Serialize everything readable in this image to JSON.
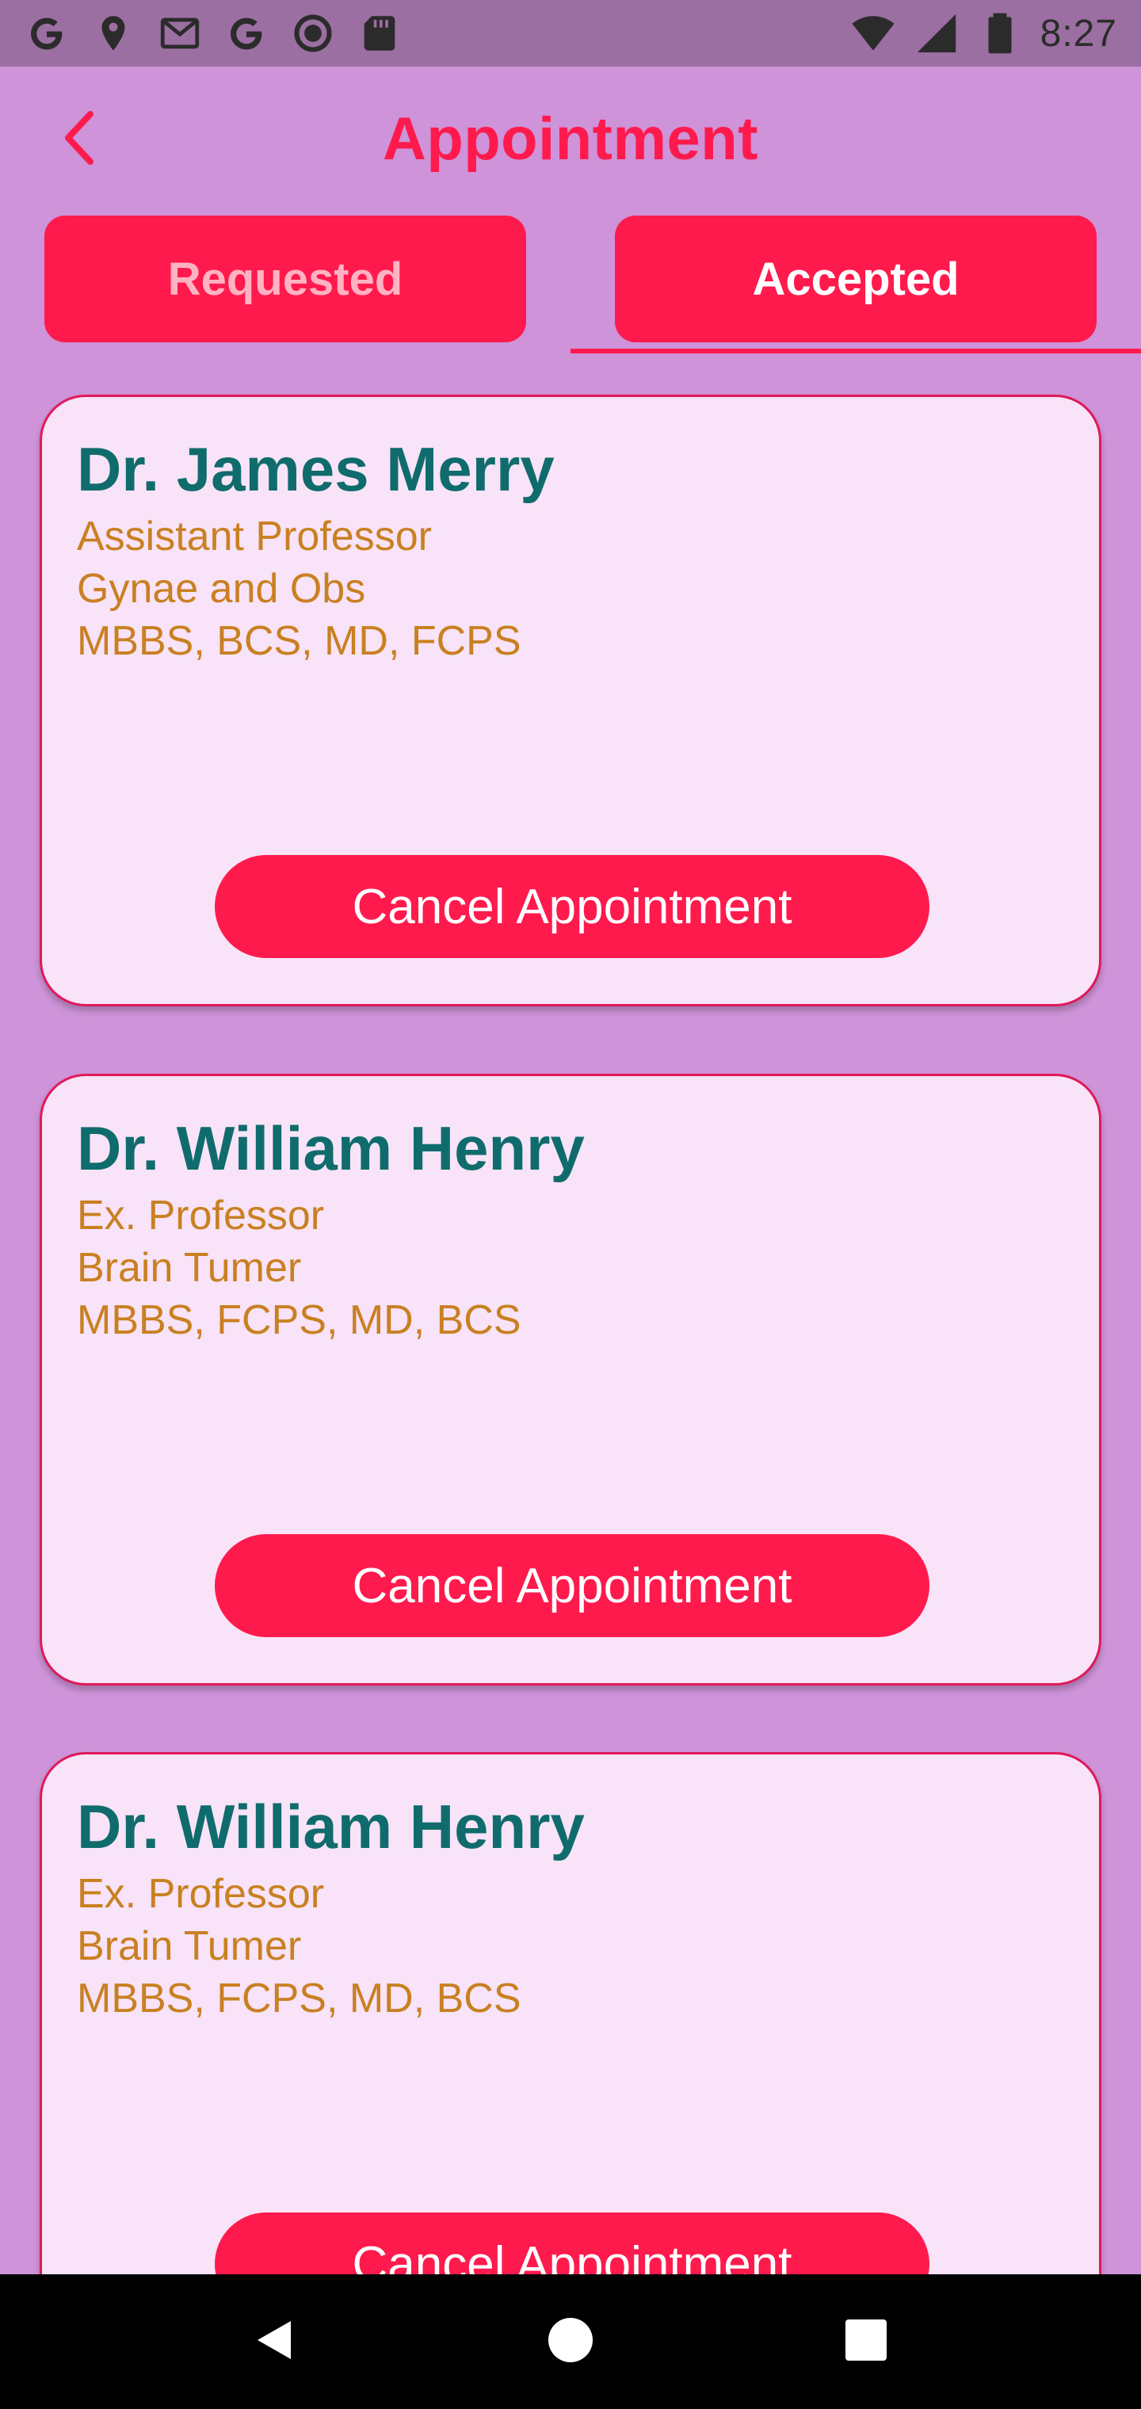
{
  "status_bar": {
    "time": "8:27",
    "left_icons": [
      "google-icon",
      "location-pin-icon",
      "gmail-icon",
      "google-icon",
      "record-icon",
      "sd-card-icon"
    ],
    "right_icons": [
      "wifi-icon",
      "cellular-signal-icon",
      "battery-icon"
    ]
  },
  "app_bar": {
    "title": "Appointment",
    "back_icon": "chevron-left-icon"
  },
  "tabs": [
    {
      "label": "Requested",
      "selected": false
    },
    {
      "label": "Accepted",
      "selected": true
    }
  ],
  "appointments": [
    {
      "name": "Dr. James Merry",
      "position": "Assistant Professor",
      "department": "Gynae and Obs",
      "degrees": "MBBS, BCS, MD, FCPS",
      "button_label": "Cancel Appointment"
    },
    {
      "name": "Dr. William Henry",
      "position": "Ex. Professor",
      "department": "Brain Tumer",
      "degrees": "MBBS, FCPS, MD, BCS",
      "button_label": "Cancel Appointment"
    },
    {
      "name": "Dr. William Henry",
      "position": "Ex. Professor",
      "department": "Brain Tumer",
      "degrees": "MBBS, FCPS, MD, BCS",
      "button_label": "Cancel Appointment"
    }
  ],
  "nav_bar": {
    "icons": [
      "back-triangle-icon",
      "home-circle-icon",
      "recents-square-icon"
    ]
  },
  "colors": {
    "background": "#ce93d8",
    "status_bar": "#9c6fa2",
    "accent": "#ff1a4d",
    "card": "#f8e3f8",
    "doctor_name": "#106c6c",
    "doctor_details": "#c98021"
  }
}
